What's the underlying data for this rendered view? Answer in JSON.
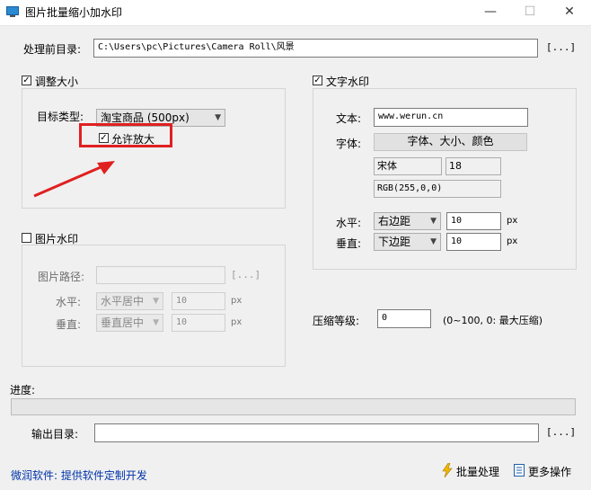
{
  "window": {
    "title": "图片批量缩小加水印",
    "minimize": "—",
    "maximize": "☐",
    "close": "✕"
  },
  "source": {
    "label": "处理前目录:",
    "value": "C:\\Users\\pc\\Pictures\\Camera Roll\\风景",
    "browse": "[...]"
  },
  "resize": {
    "checked": true,
    "label": "调整大小",
    "target_label": "目标类型:",
    "target_value": "淘宝商品 (500px)",
    "allow_enlarge_checked": true,
    "allow_enlarge_label": "允许放大"
  },
  "image_watermark": {
    "checked": false,
    "label": "图片水印",
    "path_label": "图片路径:",
    "path_value": "",
    "path_browse": "[...]",
    "h_label": "水平:",
    "h_align": "水平居中",
    "h_value": "10",
    "h_unit": "px",
    "v_label": "垂直:",
    "v_align": "垂直居中",
    "v_value": "10",
    "v_unit": "px"
  },
  "text_watermark": {
    "checked": true,
    "label": "文字水印",
    "text_label": "文本:",
    "text_value": "www.werun.cn",
    "font_label": "字体:",
    "font_button": "字体、大小、颜色",
    "font_name": "宋体",
    "font_size": "18",
    "font_color": "RGB(255,0,0)",
    "h_label": "水平:",
    "h_align": "右边距",
    "h_value": "10",
    "h_unit": "px",
    "v_label": "垂直:",
    "v_align": "下边距",
    "v_value": "10",
    "v_unit": "px"
  },
  "compression": {
    "label": "压缩等级:",
    "value": "0",
    "hint": "(0~100, 0: 最大压缩)"
  },
  "progress": {
    "label": "进度:",
    "value": 0
  },
  "output": {
    "label": "输出目录:",
    "value": "",
    "browse": "[...]"
  },
  "footer": {
    "link": "微润软件: 提供软件定制开发",
    "batch": "批量处理",
    "more": "更多操作"
  },
  "annotation": {
    "color": "#e02020"
  }
}
